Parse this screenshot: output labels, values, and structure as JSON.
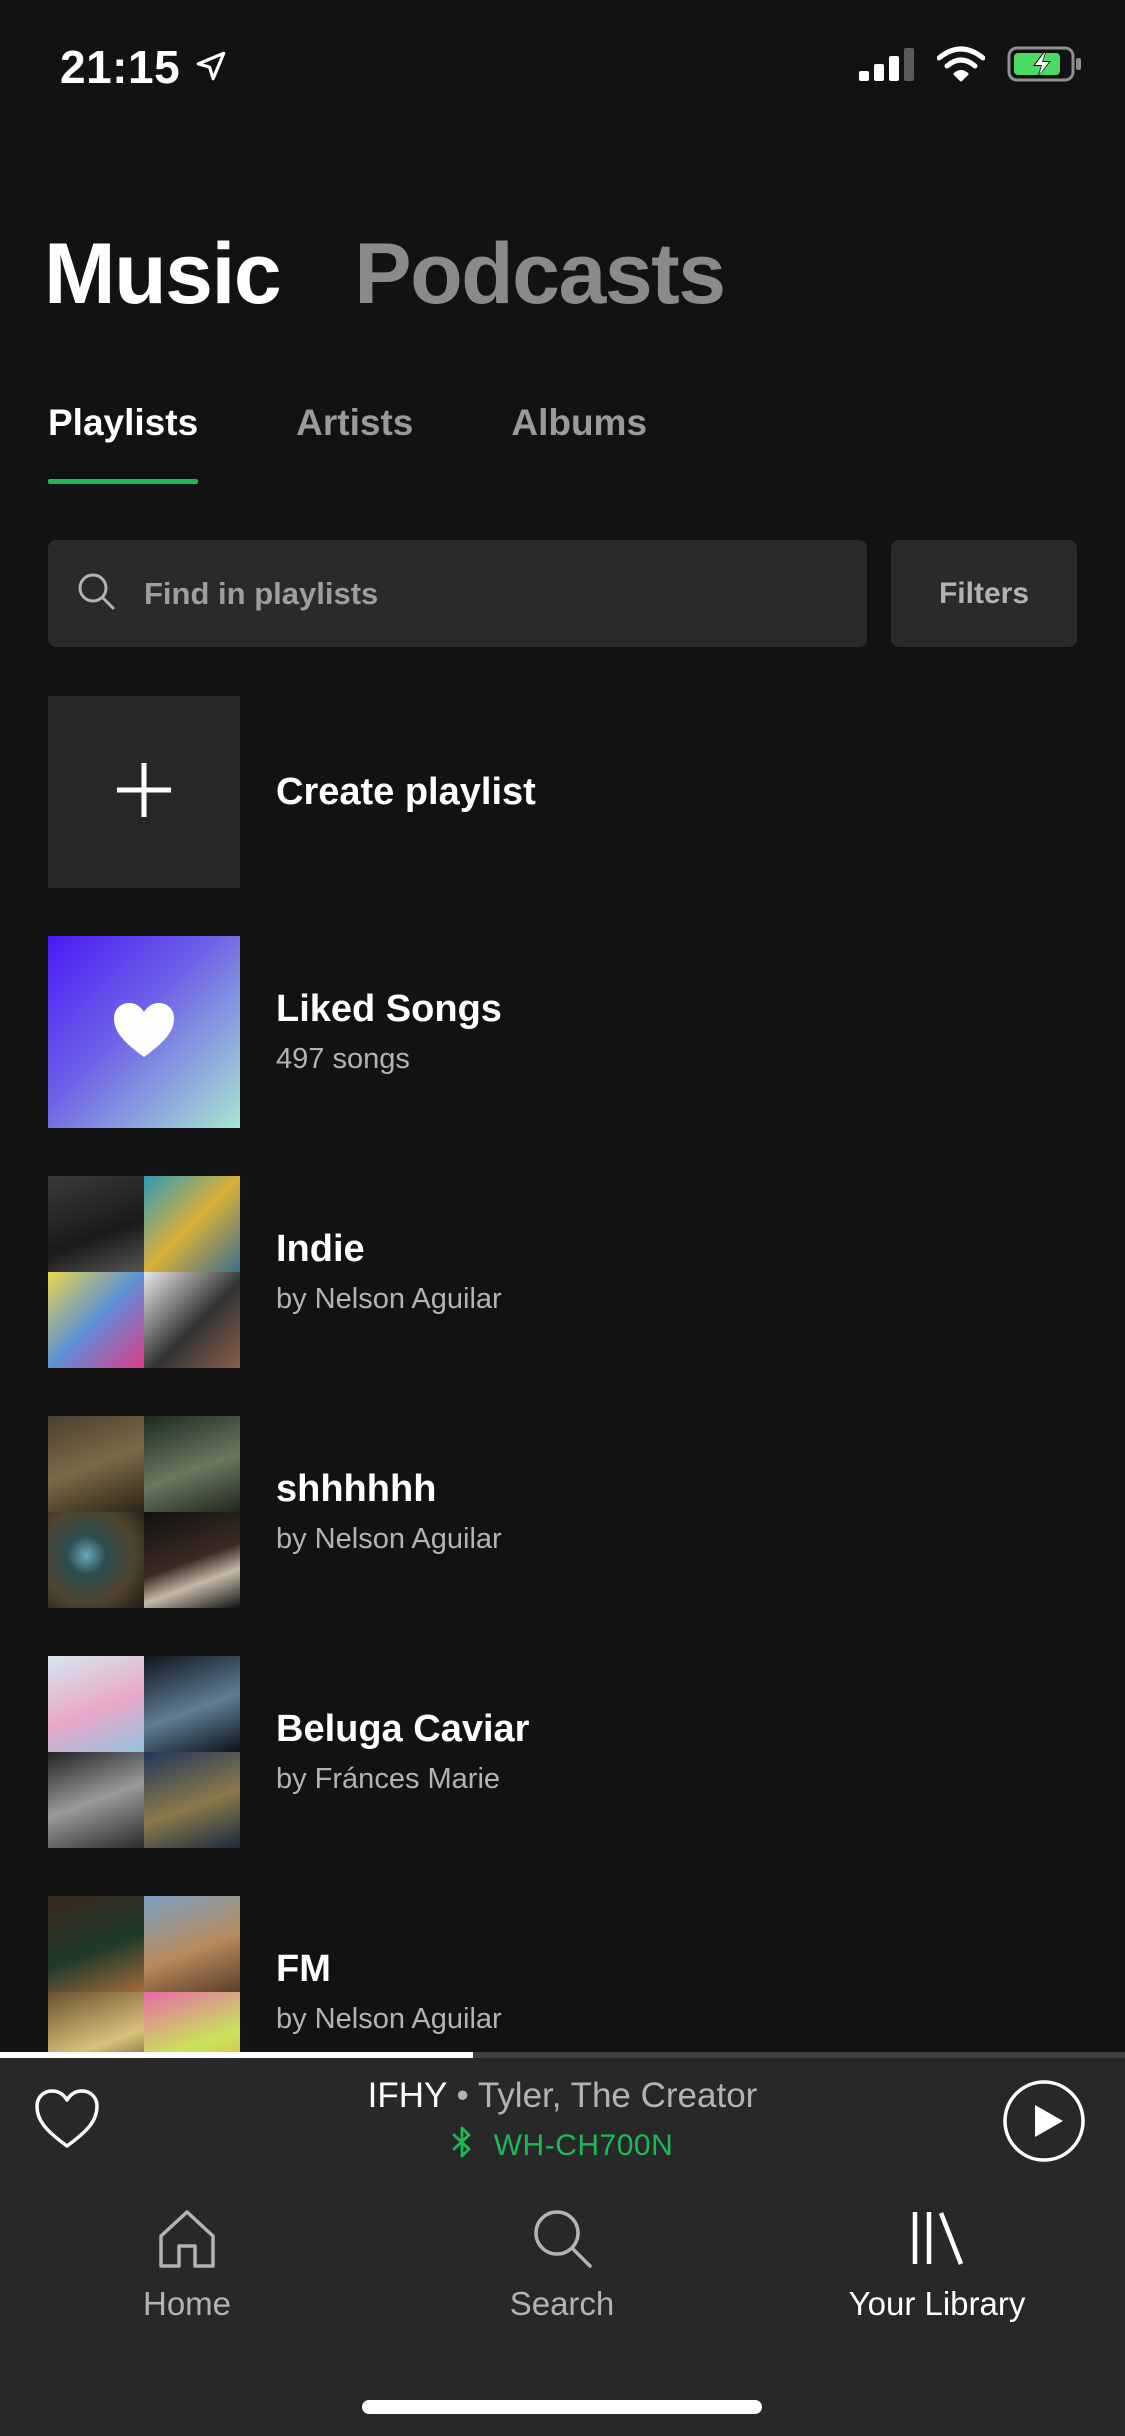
{
  "status_bar": {
    "time": "21:15"
  },
  "segments": {
    "music": "Music",
    "podcasts": "Podcasts"
  },
  "subtabs": {
    "playlists": "Playlists",
    "artists": "Artists",
    "albums": "Albums"
  },
  "search": {
    "placeholder": "Find in playlists",
    "filters_label": "Filters"
  },
  "list": {
    "create": {
      "title": "Create playlist"
    },
    "items": [
      {
        "title": "Liked Songs",
        "subtitle": "497 songs"
      },
      {
        "title": "Indie",
        "subtitle": "by Nelson Aguilar"
      },
      {
        "title": "shhhhhh",
        "subtitle": "by Nelson Aguilar"
      },
      {
        "title": "Beluga Caviar",
        "subtitle": "by Fránces Marie"
      },
      {
        "title": "FM",
        "subtitle": "by Nelson Aguilar"
      }
    ]
  },
  "mini_player": {
    "track": "IFHY",
    "separator": " • ",
    "artist": "Tyler, The Creator",
    "device": "WH-CH700N",
    "progress": 0.42
  },
  "tabbar": {
    "home": "Home",
    "search": "Search",
    "library": "Your Library"
  },
  "colors": {
    "accent": "#1db954",
    "background": "#121212",
    "surface": "#282828"
  }
}
